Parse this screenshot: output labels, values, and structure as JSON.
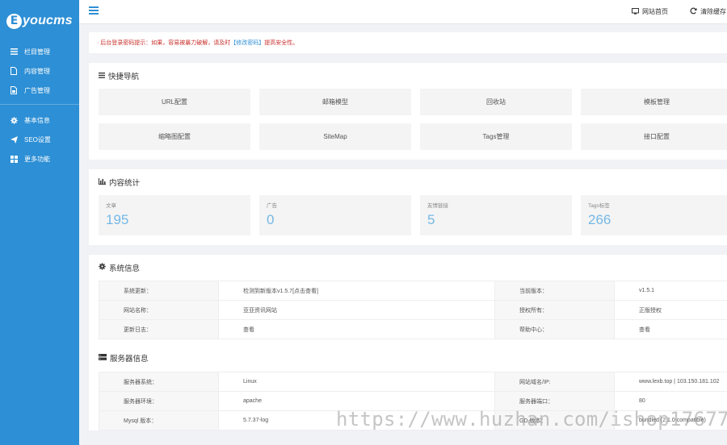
{
  "brand": {
    "mark": "E",
    "text": "youcms"
  },
  "sidebar": {
    "group1": [
      {
        "label": "栏目管理",
        "icon": "list-icon"
      },
      {
        "label": "内容管理",
        "icon": "file-icon"
      },
      {
        "label": "广告管理",
        "icon": "image-icon"
      }
    ],
    "group2": [
      {
        "label": "基本信息",
        "icon": "gear-icon"
      },
      {
        "label": "SEO设置",
        "icon": "send-icon"
      },
      {
        "label": "更多功能",
        "icon": "grid-icon"
      }
    ]
  },
  "topbar": {
    "home_label": "网站首页",
    "clear_cache_label": "清除缓存"
  },
  "alert": {
    "prefix": "· 后台登录密码提示：如果，容易被暴力破解，请及时",
    "link": "【修改密码】",
    "suffix": "提高安全性。"
  },
  "quick_nav": {
    "title": "快捷导航",
    "items": [
      "URL配置",
      "邮箱模型",
      "回收站",
      "模板管理",
      "缩略图配置",
      "SiteMap",
      "Tags管理",
      "接口配置"
    ]
  },
  "stats": {
    "title": "内容统计",
    "items": [
      {
        "label": "文章",
        "value": "195"
      },
      {
        "label": "广告",
        "value": "0"
      },
      {
        "label": "友情链接",
        "value": "5"
      },
      {
        "label": "Tags标签",
        "value": "266"
      }
    ]
  },
  "system_info": {
    "title": "系统信息",
    "rows": [
      {
        "k1": "系统更新：",
        "v1": "检测到新版本v1.5.7[点击查看]",
        "k2": "当前版本：",
        "v2": "v1.5.1"
      },
      {
        "k1": "网站名称：",
        "v1": "亚亚资讯网站",
        "k2": "授权所有：",
        "v2": "正版授权"
      },
      {
        "k1": "更新日志：",
        "v1": "查看",
        "k2": "帮助中心：",
        "v2": "查看"
      }
    ]
  },
  "server_info": {
    "title": "服务器信息",
    "rows": [
      {
        "k1": "服务器系统：",
        "v1": "Linux",
        "k2": "网站域名/IP:",
        "v2": "www.lexb.top | 103.150.181.102"
      },
      {
        "k1": "服务器环境：",
        "v1": "apache",
        "k2": "服务器端口：",
        "v2": "80"
      },
      {
        "k1": "Mysql 版本：",
        "v1": "5.7.37-log",
        "k2": "GD 版本：",
        "v2": "bundled (2.1.0 compatible)"
      }
    ]
  },
  "watermark": "https://www.huzhan.com/ishop17677",
  "colors": {
    "sidebar": "#2d8fd5",
    "accent": "#2d8fd5",
    "stat_value": "#74b8e6",
    "alert": "#d9342b"
  }
}
